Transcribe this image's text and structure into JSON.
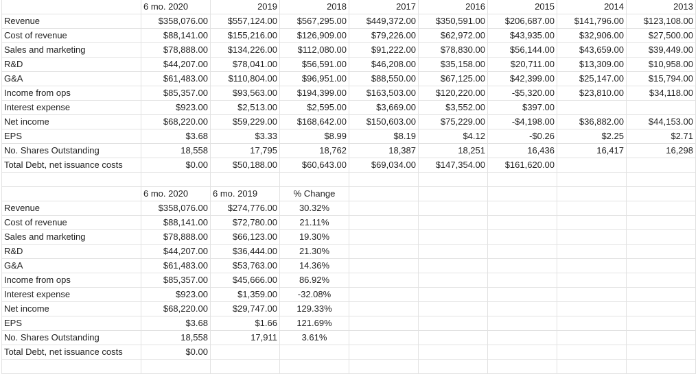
{
  "sheet": {
    "table1": {
      "headers": [
        "",
        "6 mo. 2020",
        "2019",
        "2018",
        "2017",
        "2016",
        "2015",
        "2014",
        "2013"
      ],
      "rows": [
        {
          "label": "Revenue",
          "values": [
            "$358,076.00",
            "$557,124.00",
            "$567,295.00",
            "$449,372.00",
            "$350,591.00",
            "$206,687.00",
            "$141,796.00",
            "$123,108.00"
          ]
        },
        {
          "label": "Cost of revenue",
          "values": [
            "$88,141.00",
            "$155,216.00",
            "$126,909.00",
            "$79,226.00",
            "$62,972.00",
            "$43,935.00",
            "$32,906.00",
            "$27,500.00"
          ]
        },
        {
          "label": "Sales and marketing",
          "values": [
            "$78,888.00",
            "$134,226.00",
            "$112,080.00",
            "$91,222.00",
            "$78,830.00",
            "$56,144.00",
            "$43,659.00",
            "$39,449.00"
          ]
        },
        {
          "label": "R&D",
          "values": [
            "$44,207.00",
            "$78,041.00",
            "$56,591.00",
            "$46,208.00",
            "$35,158.00",
            "$20,711.00",
            "$13,309.00",
            "$10,958.00"
          ]
        },
        {
          "label": "G&A",
          "values": [
            "$61,483.00",
            "$110,804.00",
            "$96,951.00",
            "$88,550.00",
            "$67,125.00",
            "$42,399.00",
            "$25,147.00",
            "$15,794.00"
          ]
        },
        {
          "label": "Income from ops",
          "values": [
            "$85,357.00",
            "$93,563.00",
            "$194,399.00",
            "$163,503.00",
            "$120,220.00",
            "-$5,320.00",
            "$23,810.00",
            "$34,118.00"
          ]
        },
        {
          "label": "Interest expense",
          "values": [
            "$923.00",
            "$2,513.00",
            "$2,595.00",
            "$3,669.00",
            "$3,552.00",
            "$397.00",
            "",
            ""
          ]
        },
        {
          "label": "Net income",
          "values": [
            "$68,220.00",
            "$59,229.00",
            "$168,642.00",
            "$150,603.00",
            "$75,229.00",
            "-$4,198.00",
            "$36,882.00",
            "$44,153.00"
          ]
        },
        {
          "label": "EPS",
          "values": [
            "$3.68",
            "$3.33",
            "$8.99",
            "$8.19",
            "$4.12",
            "-$0.26",
            "$2.25",
            "$2.71"
          ]
        },
        {
          "label": "No. Shares Outstanding",
          "values": [
            "18,558",
            "17,795",
            "18,762",
            "18,387",
            "18,251",
            "16,436",
            "16,417",
            "16,298"
          ]
        },
        {
          "label": "Total Debt, net issuance costs",
          "values": [
            "$0.00",
            "$50,188.00",
            "$60,643.00",
            "$69,034.00",
            "$147,354.00",
            "$161,620.00",
            "",
            ""
          ]
        }
      ]
    },
    "table2": {
      "headers": [
        "",
        "6 mo. 2020",
        "6 mo. 2019",
        "% Change",
        "",
        "",
        "",
        "",
        ""
      ],
      "rows": [
        {
          "label": "Revenue",
          "values": [
            "$358,076.00",
            "$274,776.00",
            "30.32%",
            "",
            "",
            "",
            "",
            ""
          ]
        },
        {
          "label": "Cost of revenue",
          "values": [
            "$88,141.00",
            "$72,780.00",
            "21.11%",
            "",
            "",
            "",
            "",
            ""
          ]
        },
        {
          "label": "Sales and marketing",
          "values": [
            "$78,888.00",
            "$66,123.00",
            "19.30%",
            "",
            "",
            "",
            "",
            ""
          ]
        },
        {
          "label": "R&D",
          "values": [
            "$44,207.00",
            "$36,444.00",
            "21.30%",
            "",
            "",
            "",
            "",
            ""
          ]
        },
        {
          "label": "G&A",
          "values": [
            "$61,483.00",
            "$53,763.00",
            "14.36%",
            "",
            "",
            "",
            "",
            ""
          ]
        },
        {
          "label": "Income from ops",
          "values": [
            "$85,357.00",
            "$45,666.00",
            "86.92%",
            "",
            "",
            "",
            "",
            ""
          ]
        },
        {
          "label": "Interest expense",
          "values": [
            "$923.00",
            "$1,359.00",
            "-32.08%",
            "",
            "",
            "",
            "",
            ""
          ]
        },
        {
          "label": "Net income",
          "values": [
            "$68,220.00",
            "$29,747.00",
            "129.33%",
            "",
            "",
            "",
            "",
            ""
          ]
        },
        {
          "label": "EPS",
          "values": [
            "$3.68",
            "$1.66",
            "121.69%",
            "",
            "",
            "",
            "",
            ""
          ]
        },
        {
          "label": "No. Shares Outstanding",
          "values": [
            "18,558",
            "17,911",
            "3.61%",
            "",
            "",
            "",
            "",
            ""
          ]
        },
        {
          "label": "Total Debt, net issuance costs",
          "values": [
            "$0.00",
            "",
            "",
            "",
            "",
            "",
            "",
            ""
          ]
        }
      ]
    }
  }
}
